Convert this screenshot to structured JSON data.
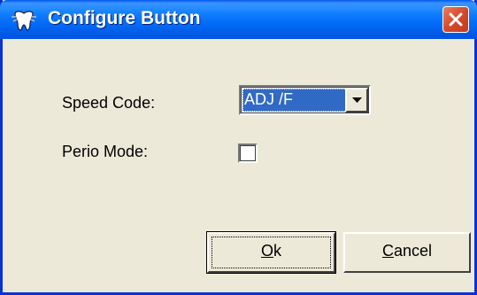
{
  "window": {
    "title": "Configure Button",
    "close_icon": "close-icon"
  },
  "form": {
    "speed_code_label": "Speed Code:",
    "speed_code_value": "ADJ /F",
    "perio_mode_label": "Perio Mode:",
    "perio_mode_checked": false
  },
  "buttons": {
    "ok_accel": "O",
    "ok_rest": "k",
    "cancel_accel": "C",
    "cancel_rest": "ancel"
  },
  "colors": {
    "titlebar": "#0054e3",
    "selection": "#316ac5",
    "dialog_bg": "#ece9d8",
    "close_button": "#d6492b"
  }
}
